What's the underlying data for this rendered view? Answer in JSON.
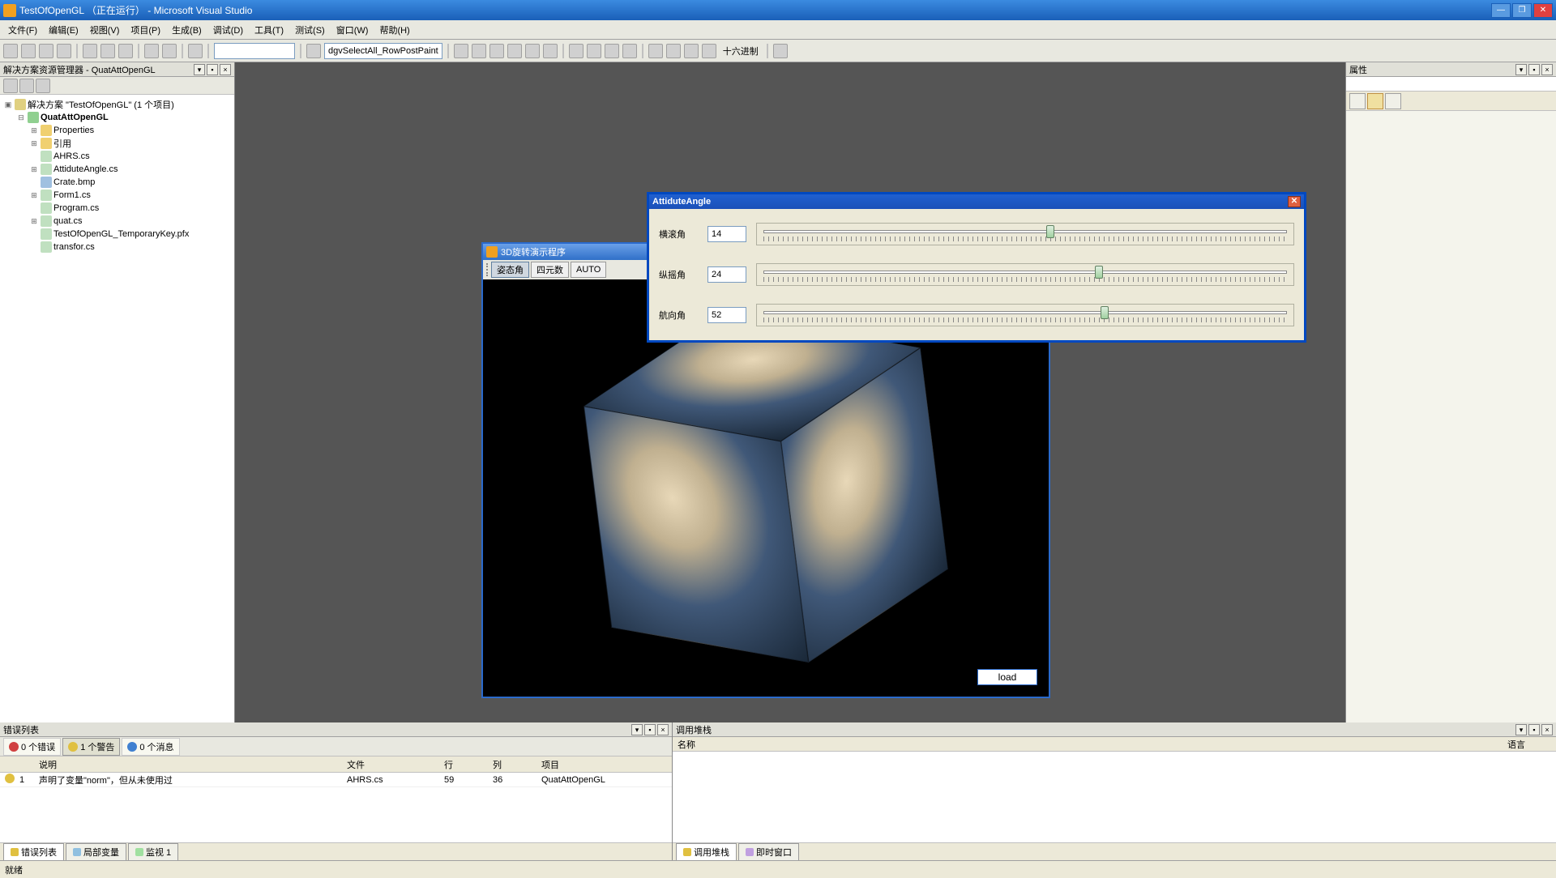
{
  "titlebar": {
    "title": "TestOfOpenGL （正在运行） - Microsoft Visual Studio"
  },
  "menu": [
    "文件(F)",
    "编辑(E)",
    "视图(V)",
    "项目(P)",
    "生成(B)",
    "调试(D)",
    "工具(T)",
    "测试(S)",
    "窗口(W)",
    "帮助(H)"
  ],
  "toolbar": {
    "combo": "dgvSelectAll_RowPostPaint",
    "hex": "十六进制"
  },
  "solution": {
    "header": "解决方案资源管理器 - QuatAttOpenGL",
    "root": "解决方案 \"TestOfOpenGL\" (1 个项目)",
    "project": "QuatAttOpenGL",
    "items": [
      {
        "label": "Properties",
        "kind": "folder",
        "exp": true
      },
      {
        "label": "引用",
        "kind": "folder",
        "exp": true
      },
      {
        "label": "AHRS.cs",
        "kind": "file"
      },
      {
        "label": "AttiduteAngle.cs",
        "kind": "file",
        "exp": true
      },
      {
        "label": "Crate.bmp",
        "kind": "bmp"
      },
      {
        "label": "Form1.cs",
        "kind": "file",
        "exp": true
      },
      {
        "label": "Program.cs",
        "kind": "file"
      },
      {
        "label": "quat.cs",
        "kind": "file",
        "exp": true
      },
      {
        "label": "TestOfOpenGL_TemporaryKey.pfx",
        "kind": "file"
      },
      {
        "label": "transfor.cs",
        "kind": "file"
      }
    ]
  },
  "props": {
    "header": "属性"
  },
  "viewer": {
    "title": "3D旋转演示程序",
    "btn_attitude": "姿态角",
    "btn_quat": "四元数",
    "btn_auto": "AUTO",
    "load": "load"
  },
  "attitude": {
    "title": "AttiduteAngle",
    "rows": [
      {
        "label": "横滚角",
        "value": "14",
        "pos": 54
      },
      {
        "label": "纵摇角",
        "value": "24",
        "pos": 63
      },
      {
        "label": "航向角",
        "value": "52",
        "pos": 64
      }
    ]
  },
  "errors": {
    "header": "错误列表",
    "filters": {
      "err": "0 个错误",
      "warn": "1 个警告",
      "msg": "0 个消息"
    },
    "cols": {
      "desc": "说明",
      "file": "文件",
      "line": "行",
      "col": "列",
      "proj": "项目"
    },
    "rows": [
      {
        "n": "1",
        "desc": "声明了变量\"norm\"，但从未使用过",
        "file": "AHRS.cs",
        "line": "59",
        "col": "36",
        "proj": "QuatAttOpenGL"
      }
    ],
    "tabs": {
      "err": "错误列表",
      "locals": "局部变量",
      "watch": "监视 1"
    }
  },
  "callstack": {
    "header": "调用堆栈",
    "cols": {
      "name": "名称",
      "lang": "语言"
    },
    "tabs": {
      "call": "调用堆栈",
      "imm": "即时窗口"
    }
  },
  "status": "就绪"
}
